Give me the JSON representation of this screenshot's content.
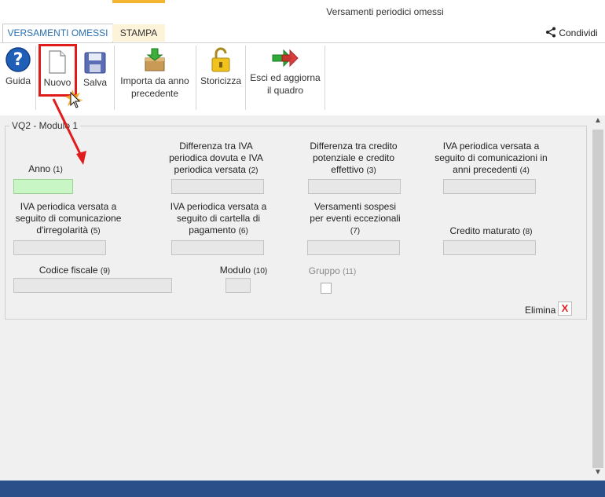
{
  "window": {
    "title": "Versamenti periodici omessi"
  },
  "tabs": [
    {
      "label": "VERSAMENTI OMESSI"
    },
    {
      "label": "STAMPA"
    }
  ],
  "share": {
    "label": "Condividi"
  },
  "ribbon": {
    "buttons": [
      {
        "label": "Guida"
      },
      {
        "label": "Nuovo"
      },
      {
        "label": "Salva"
      },
      {
        "label": "Importa da anno precedente"
      },
      {
        "label": "Storicizza"
      },
      {
        "label": "Esci ed aggiorna il quadro"
      }
    ]
  },
  "group": {
    "title": "VQ2 - Modulo 1"
  },
  "fields": [
    {
      "label": "Anno",
      "num": "(1)"
    },
    {
      "label": "Differenza tra IVA periodica dovuta e IVA periodica versata",
      "num": "(2)"
    },
    {
      "label": "Differenza tra credito potenziale e credito effettivo",
      "num": "(3)"
    },
    {
      "label": "IVA periodica versata a seguito di comunicazioni in anni precedenti",
      "num": "(4)"
    },
    {
      "label": "IVA periodica versata a seguito di comunicazione d'irregolarità",
      "num": "(5)"
    },
    {
      "label": "IVA periodica versata a seguito di cartella di pagamento",
      "num": "(6)"
    },
    {
      "label": "Versamenti sospesi per eventi eccezionali",
      "num": "(7)"
    },
    {
      "label": "Credito maturato",
      "num": "(8)"
    },
    {
      "label": "Codice fiscale",
      "num": "(9)"
    },
    {
      "label": "Modulo",
      "num": "(10)"
    },
    {
      "label": "Gruppo",
      "num": "(11)"
    }
  ],
  "actions": {
    "elimina": "Elimina",
    "elimina_x": "X"
  },
  "colors": {
    "accent": "#2a6fb0",
    "status_bar": "#2b4f88",
    "highlight": "#e01b1b",
    "active_field": "#c8f7c5"
  }
}
